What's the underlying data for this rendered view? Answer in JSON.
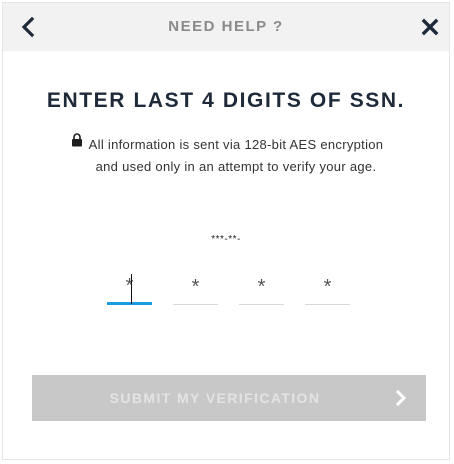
{
  "header": {
    "title": "NEED HELP ?",
    "back_icon": "chevron-left-icon",
    "close_icon": "close-icon"
  },
  "main": {
    "title": "ENTER LAST 4 DIGITS OF SSN.",
    "lock_icon": "lock-icon",
    "info_text": "All information is sent via 128-bit AES encryption and used only in an attempt to verify your age.",
    "ssn_format": "***-**-",
    "digits": [
      {
        "placeholder": "*"
      },
      {
        "placeholder": "*"
      },
      {
        "placeholder": "*"
      },
      {
        "placeholder": "*"
      }
    ],
    "active_digit_index": 0
  },
  "submit": {
    "label": "SUBMIT MY VERIFICATION",
    "icon": "chevron-right-icon",
    "enabled": false
  },
  "colors": {
    "header_bg": "#f2f2f2",
    "title_text": "#1e2a3a",
    "active_underline": "#1a9be0",
    "button_disabled_bg": "#c8c8c8",
    "button_disabled_text": "#e3e3e3"
  }
}
